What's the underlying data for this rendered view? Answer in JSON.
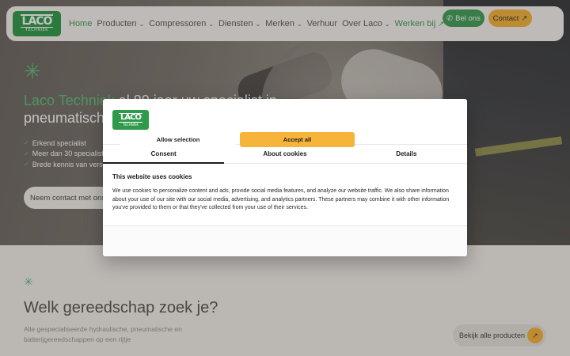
{
  "header": {
    "logo": {
      "big": "LACO",
      "small": "TECHNIEK"
    },
    "nav": [
      {
        "label": "Home",
        "chevron": false
      },
      {
        "label": "Producten",
        "chevron": true
      },
      {
        "label": "Compressoren",
        "chevron": true
      },
      {
        "label": "Diensten",
        "chevron": true
      },
      {
        "label": "Merken",
        "chevron": true
      },
      {
        "label": "Verhuur",
        "chevron": false
      },
      {
        "label": "Over Laco",
        "chevron": true
      },
      {
        "label": "Werken bij",
        "external": true
      }
    ],
    "call_label": "Bel ons",
    "contact_label": "Contact"
  },
  "hero": {
    "title_highlight": "Laco Techniek",
    "title_rest": " al 80 jaar uw specialist in pneumatisch",
    "checks": [
      "Erkend specialist",
      "Meer dan 30 specialiste",
      "Brede kennis van versc"
    ],
    "cta_label": "Neem contact met ons"
  },
  "section": {
    "title": "Welk gereedschap zoek je?",
    "subtitle": "Alle gespecialiseerde hydraulische, pneumatische en batterijgereedschappen op een rijtje",
    "all_products_label": "Bekijk alle producten"
  },
  "cookie_dialog": {
    "tabs": [
      "Consent",
      "About cookies",
      "Details"
    ],
    "active_tab": "Consent",
    "heading": "This website uses cookies",
    "body": "We use cookies to personalize content and ads, provide social media features, and analyze our website traffic. We also share information about your use of our site with our social media, advertising, and analytics partners. These partners may combine it with other information you've provided to them or that they've collected from your use of their services.",
    "allow_selection_label": "Allow selection",
    "accept_all_label": "Accept all"
  },
  "colors": {
    "brand_green": "#3f9e57",
    "accent_orange": "#f7b43a",
    "background": "#f4f0ec"
  }
}
